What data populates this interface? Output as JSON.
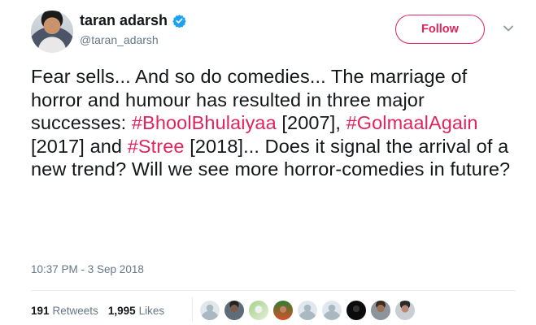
{
  "author": {
    "name": "taran adarsh",
    "handle": "@taran_adarsh"
  },
  "follow_label": "Follow",
  "tweet": {
    "parts": [
      {
        "text": "Fear sells... And so do comedies... The marriage of horror and humour has resulted in three major successes: ",
        "hashtag": false
      },
      {
        "text": "#BhoolBhulaiyaa",
        "hashtag": true
      },
      {
        "text": " [2007], ",
        "hashtag": false
      },
      {
        "text": "#GolmaalAgain",
        "hashtag": true
      },
      {
        "text": " [2017] and ",
        "hashtag": false
      },
      {
        "text": "#Stree",
        "hashtag": true
      },
      {
        "text": " [2018]... Does it signal the arrival of a new trend? Will we see more horror-comedies in future?",
        "hashtag": false
      }
    ]
  },
  "timestamp": "10:37 PM - 3 Sep 2018",
  "stats": {
    "retweets_count": "191",
    "retweets_label": "Retweets",
    "likes_count": "1,995",
    "likes_label": "Likes"
  },
  "colors": {
    "accent": "#e0245e",
    "verified": "#1da1f2",
    "muted": "#657786"
  },
  "likers": [
    "default",
    "l1",
    "l2",
    "l3",
    "default",
    "default",
    "l4",
    "l5",
    "l6"
  ]
}
